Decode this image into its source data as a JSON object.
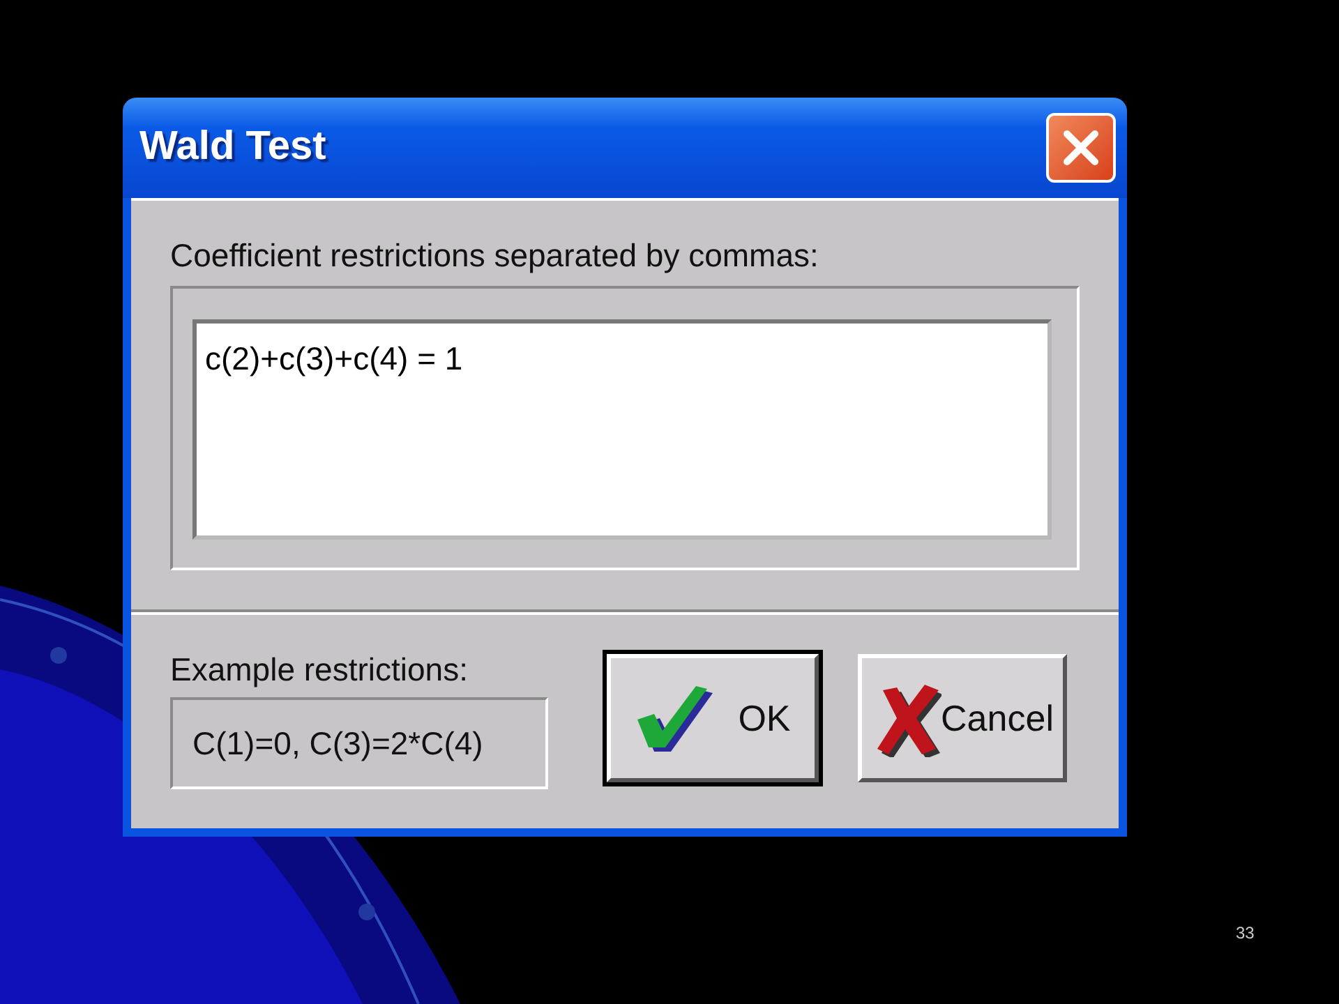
{
  "window": {
    "title": "Wald Test"
  },
  "restrictions": {
    "label": "Coefficient restrictions separated by commas:",
    "value": "c(2)+c(3)+c(4) = 1"
  },
  "example": {
    "label": "Example restrictions:",
    "value": "C(1)=0, C(3)=2*C(4)"
  },
  "buttons": [
    {
      "label": "OK",
      "kind": "ok",
      "default": true
    },
    {
      "label": "Cancel",
      "kind": "cancel",
      "default": false
    }
  ],
  "slide_number": "33"
}
